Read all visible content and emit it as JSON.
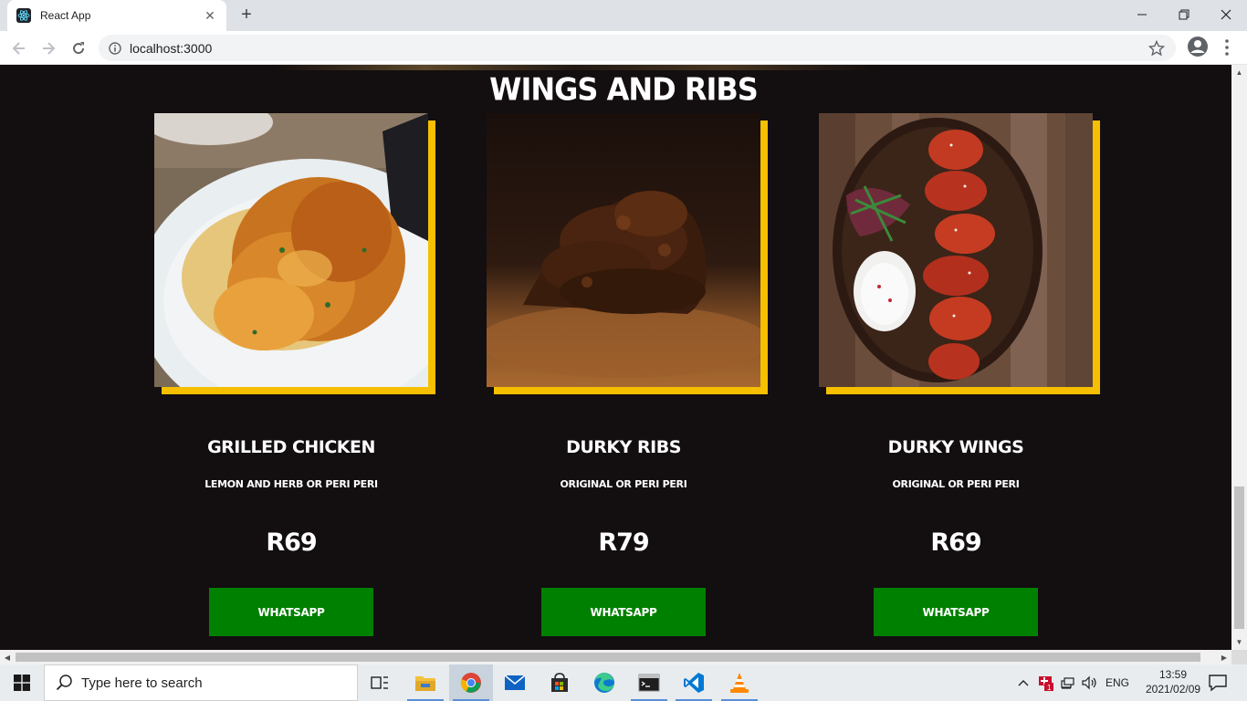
{
  "browser": {
    "tab_title": "React App",
    "url": "localhost:3000",
    "tab_close": "✕",
    "new_tab": "+",
    "minimize": "—",
    "restore": "❐",
    "close": "✕"
  },
  "page": {
    "section_title": "WINGS AND RIBS",
    "accent_color": "#f6bf00",
    "button_color": "#008000",
    "background_color": "#130e0f",
    "items": [
      {
        "name": "GRILLED CHICKEN",
        "description": "LEMON AND HERB OR PERI PERI",
        "price": "R69",
        "button": "WHATSAPP"
      },
      {
        "name": "DURKY RIBS",
        "description": "ORIGINAL OR PERI PERI",
        "price": "R79",
        "button": "WHATSAPP"
      },
      {
        "name": "DURKY WINGS",
        "description": "ORIGINAL OR PERI PERI",
        "price": "R69",
        "button": "WHATSAPP"
      }
    ]
  },
  "taskbar": {
    "search_placeholder": "Type here to search",
    "language": "ENG",
    "time": "13:59",
    "date": "2021/02/09",
    "apps": [
      "task-view-icon",
      "file-explorer-icon",
      "chrome-icon",
      "mail-icon",
      "store-icon",
      "edge-icon",
      "terminal-icon",
      "vscode-icon",
      "vlc-icon"
    ]
  }
}
